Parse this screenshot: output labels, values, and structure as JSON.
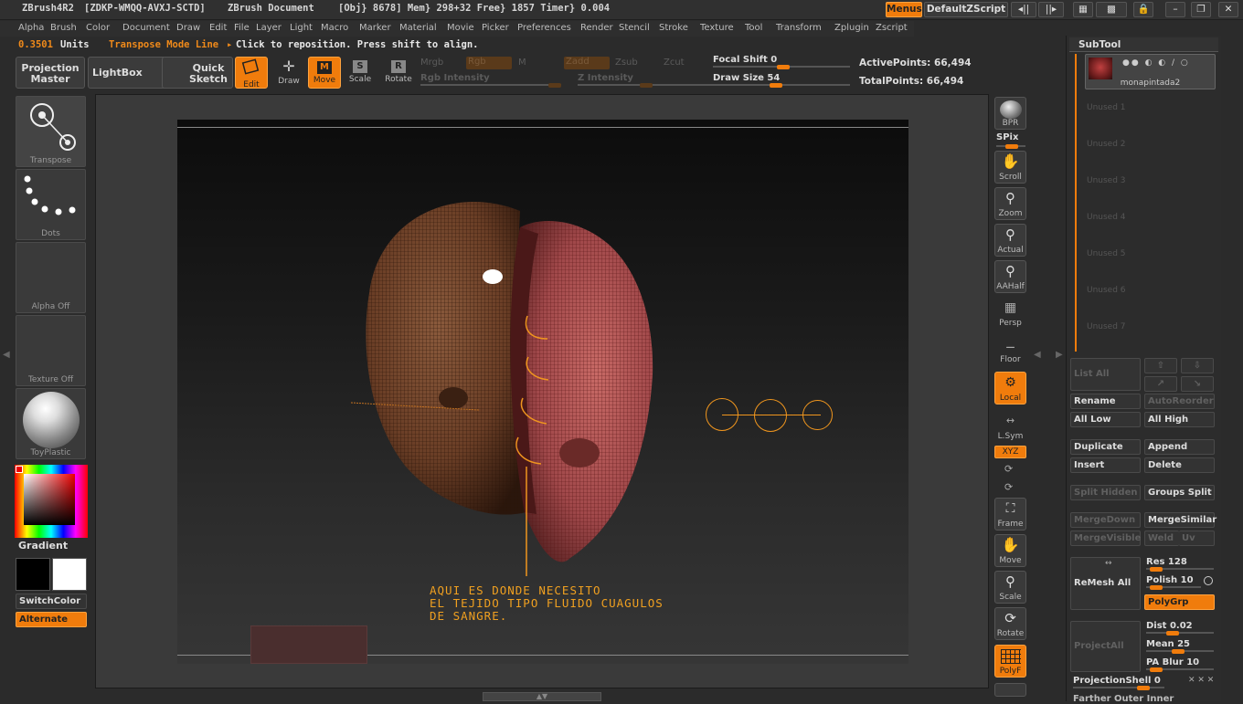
{
  "title": {
    "app": "ZBrush4R2",
    "serial": "[ZDKP-WMQQ-AVXJ-SCTD]",
    "document": "ZBrush Document",
    "stats": "[Obj} 8678] Mem} 298+32 Free} 1857 Timer} 0.004",
    "menus_button": "Menus",
    "script_button": "DefaultZScript"
  },
  "menu": [
    "Alpha",
    "Brush",
    "Color",
    "Document",
    "Draw",
    "Edit",
    "File",
    "Layer",
    "Light",
    "Macro",
    "Marker",
    "Material",
    "Movie",
    "Picker",
    "Preferences",
    "Render",
    "Stencil",
    "Stroke",
    "Texture",
    "Tool",
    "Transform",
    "Zplugin",
    "Zscript"
  ],
  "status": {
    "units_value": "0.3501",
    "units_label": "Units",
    "mode": "Transpose Mode Line",
    "hint": "Click to reposition. Press shift to align."
  },
  "toolbar": {
    "projection_master": "Projection Master",
    "lightbox": "LightBox",
    "quick_sketch": "Quick Sketch",
    "edit": "Edit",
    "draw": "Draw",
    "move": "Move",
    "scale": "Scale",
    "rotate": "Rotate",
    "mrgb": "Mrgb",
    "rgb": "Rgb",
    "m": "M",
    "zadd": "Zadd",
    "zsub": "Zsub",
    "zcut": "Zcut",
    "rgb_intensity": "Rgb Intensity",
    "z_intensity": "Z Intensity",
    "focal_shift_label": "Focal Shift",
    "focal_shift_value": "0",
    "draw_size_label": "Draw Size",
    "draw_size_value": "54",
    "active_points": "ActivePoints: 66,494",
    "total_points": "TotalPoints: 66,494"
  },
  "left_shelf": {
    "transpose": "Transpose",
    "dots": "Dots",
    "alpha": "Alpha  Off",
    "texture": "Texture  Off",
    "material": "ToyPlastic",
    "gradient": "Gradient",
    "switch_color": "SwitchColor",
    "alternate": "Alternate"
  },
  "right_shelf": {
    "bpr": "BPR",
    "spix": "SPix",
    "scroll": "Scroll",
    "zoom": "Zoom",
    "actual": "Actual",
    "aahalf": "AAHalf",
    "persp": "Persp",
    "floor": "Floor",
    "local": "Local",
    "lsym": "L.Sym",
    "xyz": "XYZ",
    "frame": "Frame",
    "move": "Move",
    "scale": "Scale",
    "rotate": "Rotate",
    "polyf": "PolyF"
  },
  "annotation": "AQUI ES DONDE NECESITO\nEL TEJIDO TIPO FLUIDO CUAGULOS\nDE SANGRE.",
  "subtool": {
    "header": "SubTool",
    "active": "monapintada2",
    "unused": [
      "Unused  1",
      "Unused  2",
      "Unused  3",
      "Unused  4",
      "Unused  5",
      "Unused  6",
      "Unused  7"
    ],
    "list_all": "List  All",
    "rename": "Rename",
    "auto_reorder": "AutoReorder",
    "all_low": "All  Low",
    "all_high": "All  High",
    "duplicate": "Duplicate",
    "append": "Append",
    "insert": "Insert",
    "delete": "Delete",
    "split_hidden": "Split  Hidden",
    "groups_split": "Groups  Split",
    "merge_down": "MergeDown",
    "merge_similar": "MergeSimilar",
    "merge_visible": "MergeVisible",
    "weld": "Weld",
    "uv": "Uv",
    "remesh_all": "ReMesh  All",
    "res_label": "Res",
    "res_value": "128",
    "polish_label": "Polish",
    "polish_value": "10",
    "polygrp": "PolyGrp",
    "project_all": "ProjectAll",
    "dist_label": "Dist",
    "dist_value": "0.02",
    "mean_label": "Mean",
    "mean_value": "25",
    "pa_blur_label": "PA  Blur",
    "pa_blur_value": "10",
    "projection_shell_label": "ProjectionShell",
    "projection_shell_value": "0",
    "footer": "Farther  Outer  Inner"
  },
  "colors": {
    "accent": "#f07c0c",
    "panel_bg": "#2c2c2c",
    "viewport_bg": "#3a3a3a"
  }
}
